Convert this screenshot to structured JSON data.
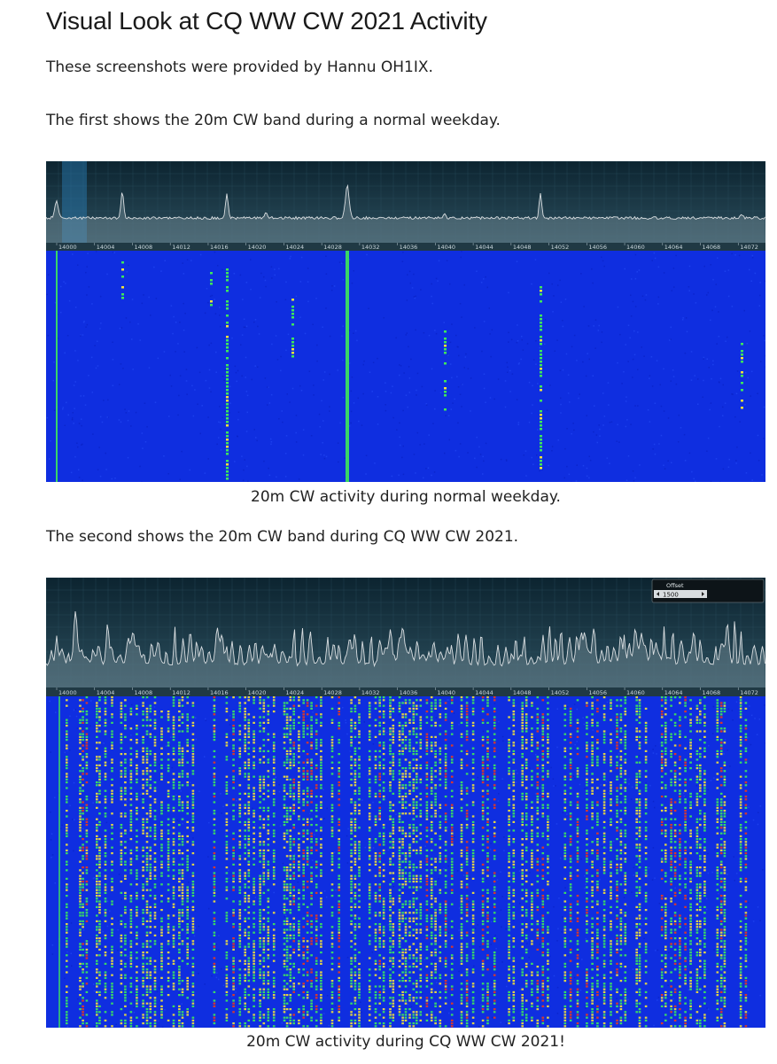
{
  "page": {
    "title": "Visual Look at CQ WW CW 2021 Activity",
    "intro": "These screenshots were provided by Hannu OH1IX.",
    "first_text": "The first shows the 20m CW band during a normal weekday.",
    "first_caption": "20m CW activity during normal weekday.",
    "second_text": "The second shows the 20m CW band during CQ WW CW 2021.",
    "second_caption": "20m CW activity during CQ WW CW 2021!"
  },
  "spectrum": {
    "freq_labels": [
      "14000",
      "14004",
      "14008",
      "14012",
      "14016",
      "14020",
      "14024",
      "14028",
      "14032",
      "14036",
      "14040",
      "14044",
      "14048",
      "14052",
      "14056",
      "14060",
      "14064",
      "14068",
      "14072"
    ],
    "offset_panel": {
      "title": "Offset",
      "value": "1500"
    }
  },
  "colors": {
    "waterfall_bg": "#0f2ee0",
    "signal_green": "#3ee85a",
    "signal_yellow": "#f2e23a",
    "signal_red": "#e83a1e",
    "spectrum_bg": "#163542",
    "trace": "#d8dde0"
  }
}
